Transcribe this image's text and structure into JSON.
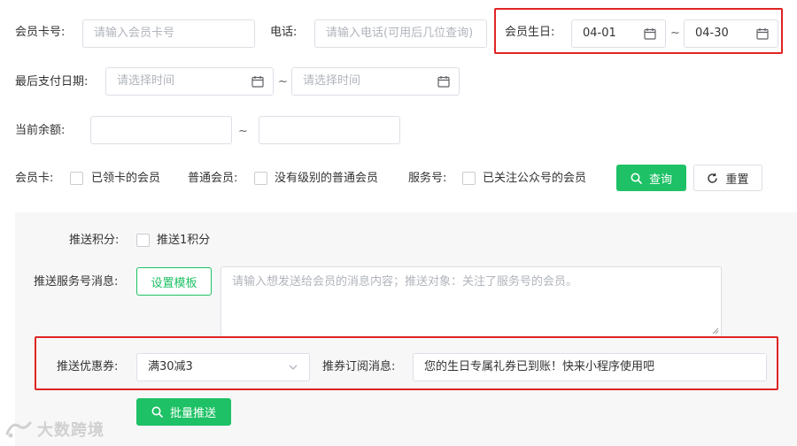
{
  "filters": {
    "card_no": {
      "label": "会员卡号:",
      "placeholder": "请输入会员卡号"
    },
    "phone": {
      "label": "电话:",
      "placeholder": "请输入电话(可用后几位查询)"
    },
    "birthday": {
      "label": "会员生日:",
      "from": "04-01",
      "separator": "~",
      "to": "04-30"
    },
    "last_pay": {
      "label": "最后支付日期:",
      "from_placeholder": "请选择时间",
      "separator": "~",
      "to_placeholder": "请选择时间"
    },
    "balance": {
      "label": "当前余额:",
      "separator": "~"
    },
    "member_card": {
      "label": "会员卡:",
      "option": "已领卡的会员"
    },
    "regular_member": {
      "label": "普通会员:",
      "option": "没有级别的普通会员"
    },
    "service_account": {
      "label": "服务号:",
      "option": "已关注公众号的会员"
    },
    "search_label": "查询",
    "reset_label": "重置"
  },
  "push": {
    "points": {
      "label": "推送积分:",
      "option": "推送1积分"
    },
    "service_msg": {
      "label": "推送服务号消息:",
      "template_button": "设置模板",
      "placeholder": "请输入想发送给会员的消息内容；推送对象：关注了服务号的会员。"
    },
    "coupon": {
      "label": "推送优惠券:",
      "value": "满30减3"
    },
    "subscribe_msg": {
      "label": "推券订阅消息:",
      "value": "您的生日专属礼券已到账！快来小程序使用吧"
    },
    "batch_button": "批量推送"
  },
  "watermark": "大数跨境",
  "icons": {
    "calendar": "calendar-icon",
    "search": "search-icon",
    "refresh": "refresh-icon",
    "chevron": "chevron-down-icon"
  },
  "colors": {
    "accent_green": "#1ec165",
    "highlight_red": "#e02424",
    "panel_bg": "#f7f7f7"
  }
}
